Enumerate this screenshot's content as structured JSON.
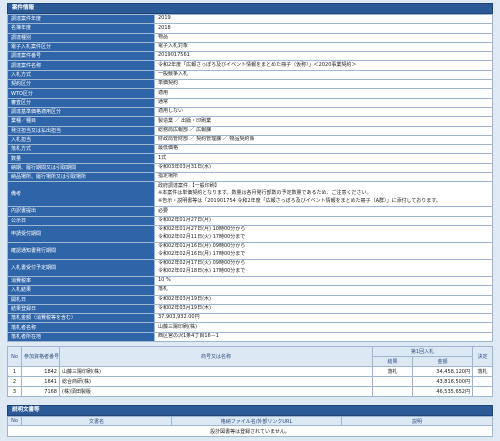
{
  "sections": {
    "info_title": "案件情報",
    "docs_title": "説明文書等"
  },
  "info_rows": [
    {
      "label": "調達案件年度",
      "lines": [
        "2019"
      ]
    },
    {
      "label": "名簿年度",
      "lines": [
        "2018"
      ]
    },
    {
      "label": "調達種別",
      "lines": [
        "物品"
      ]
    },
    {
      "label": "電子入札案件区分",
      "lines": [
        "電子入札対象"
      ]
    },
    {
      "label": "調達案件番号",
      "lines": [
        "2019017561"
      ]
    },
    {
      "label": "調達案件名称",
      "lines": [
        "令和2年度「広報さっぽろ及びイベント情報をまとめた冊子（仮称）」＜2020事業契約＞"
      ]
    },
    {
      "label": "入札方式",
      "lines": [
        "一般競争入札"
      ]
    },
    {
      "label": "契約区分",
      "lines": [
        "単価契約"
      ]
    },
    {
      "label": "WTO区分",
      "lines": [
        "適用"
      ]
    },
    {
      "label": "審査区分",
      "lines": [
        "通常"
      ]
    },
    {
      "label": "調達基準価格適用区分",
      "lines": [
        "適用しない"
      ]
    },
    {
      "label": "業種／種目",
      "lines": [
        "製造業 ／ 出版・印刷業"
      ]
    },
    {
      "label": "発注担当又は払出担当",
      "lines": [
        "総務局広報部 ／ 広報課"
      ]
    },
    {
      "label": "入札担当",
      "lines": [
        "財政局管財部 ／ 契約管理課 ／ 物品契約係"
      ]
    },
    {
      "label": "落札方式",
      "lines": [
        "最低価格"
      ]
    },
    {
      "label": "数量",
      "lines": [
        "1式"
      ]
    },
    {
      "label": "納期、履行期間又は引取期間",
      "lines": [
        "令和03年03月31日(水)"
      ]
    },
    {
      "label": "納品場所、履行場所又は引取場所",
      "lines": [
        "指定場所"
      ]
    },
    {
      "label": "備考",
      "tall": true,
      "lines": [
        "政府調達案件 【一般印刷】",
        "※本案件は単価契約となります。数量は各月発行部数の予定数量であるため、ご注意ください。",
        "※告示・説明書等は「201901754 令和2年度「広報さっぽろ及びイベント情報をまとめた冊子（A群）」に添付しております。"
      ]
    },
    {
      "label": "内訳書提出",
      "lines": [
        "必要"
      ]
    },
    {
      "label": "公示日",
      "lines": [
        "令和02年01月27日(月)"
      ]
    },
    {
      "label": "申請受付期間",
      "tall2": true,
      "lines": [
        "令和02年01月27日(月) 10時00分から",
        "令和02年02月11日(火) 17時00分まで"
      ]
    },
    {
      "label": "確認通知書発行期間",
      "tall2": true,
      "lines": [
        "令和02年01月16日(月) 09時00分から",
        "令和02年02月16日(月) 17時00分まで"
      ]
    },
    {
      "label": "入札書受付予定期間",
      "tall2": true,
      "lines": [
        "令和02年02月17日(火) 09時00分から",
        "令和02年02月18日(水) 17時00分まで"
      ]
    },
    {
      "label": "消費税率",
      "lines": [
        "10 %"
      ]
    },
    {
      "label": "入札結果",
      "lines": [
        "落札"
      ]
    },
    {
      "label": "開札日",
      "lines": [
        "令和02年03月19日(木)"
      ]
    },
    {
      "label": "結果登録日",
      "lines": [
        "令和02年03月19日(木)"
      ]
    },
    {
      "label": "落札金額（消費税等を含む）",
      "lines": [
        "37,903,932.00円"
      ]
    },
    {
      "label": "落札者名称",
      "lines": [
        "山藤三陽印刷(株)"
      ]
    },
    {
      "label": "落札者所在地",
      "lines": [
        "西区宮の沢1条4丁目16－1"
      ]
    }
  ],
  "bids": {
    "headers": {
      "no": "No",
      "reg_no": "参加資格者番号",
      "name": "商号又は名称",
      "round1": "第1回入札",
      "result": "結果",
      "amount": "金額",
      "decision": "決定"
    },
    "rows": [
      {
        "no": "1",
        "reg_no": "1842",
        "name": "山藤三陽印刷(株)",
        "result": "落札",
        "amount": "34,458,120円",
        "decision": "落札"
      },
      {
        "no": "2",
        "reg_no": "1841",
        "name": "総合商研(株)",
        "result": "",
        "amount": "43,816,500円",
        "decision": ""
      },
      {
        "no": "3",
        "reg_no": "7168",
        "name": "(株)須田製版",
        "result": "",
        "amount": "46,535,652円",
        "decision": ""
      }
    ]
  },
  "docs": {
    "headers": {
      "no": "No",
      "doc_name": "文書名",
      "file_name": "格納ファイル名/外部リンクURL",
      "desc": "説明"
    },
    "empty_message": "設計図書等は登録されていません。"
  }
}
